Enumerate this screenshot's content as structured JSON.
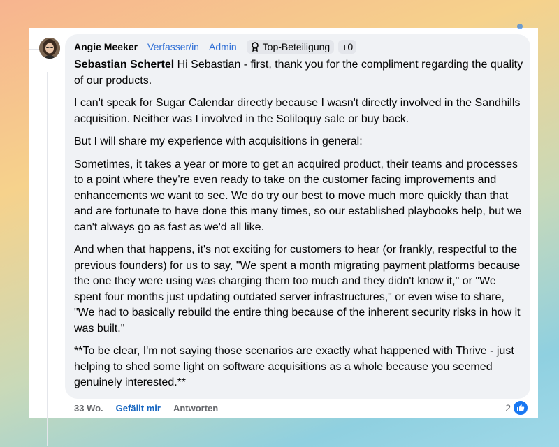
{
  "comment": {
    "author": "Angie Meeker",
    "roles": [
      "Verfasser/in",
      "Admin"
    ],
    "badge_label": "Top-Beteiligung",
    "extra_badges": "+0",
    "mention": "Sebastian Schertel",
    "paragraphs": [
      " Hi Sebastian - first, thank you for the compliment regarding the quality of our products.",
      "I can't speak for Sugar Calendar directly because I wasn't directly involved in the Sandhills acquisition. Neither was I involved in the Soliloquy sale or buy back.",
      "But I will share my experience with acquisitions in general:",
      "Sometimes, it takes a year or more to get an acquired product, their teams and processes to a point where they're even ready to take on the customer facing improvements and enhancements we want to see. We do try our best to move much more quickly than that and are fortunate to have done this many times, so our established playbooks help, but we can't always go as fast as we'd all like.",
      "And when that happens, it's not exciting for customers to hear (or frankly, respectful to the previous founders) for us to say, \"We spent a month migrating payment platforms because the one they were using was charging them too much and they didn't know it,\" or \"We spent four months just updating outdated server infrastructures,\" or even wise to share, \"We had to basically rebuild the entire thing because of the inherent security risks in how it was built.\"",
      "**To be clear, I'm not saying those scenarios are exactly what happened with Thrive - just helping to shed some light on software acquisitions as a whole because you seemed genuinely interested.**"
    ]
  },
  "footer": {
    "time": "33 Wo.",
    "like_label": "Gefällt mir",
    "reply_label": "Antworten",
    "reaction_count": "2",
    "reaction_icon": "thumbs-up-icon"
  },
  "colors": {
    "link_blue": "#2f6fd6",
    "like_blue": "#1877f2",
    "bubble_bg": "#f0f2f5"
  }
}
